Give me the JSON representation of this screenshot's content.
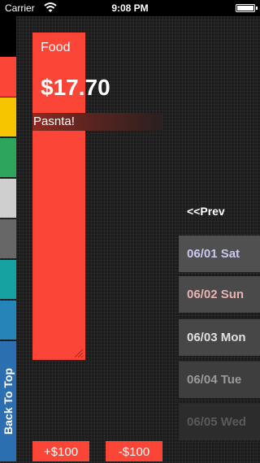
{
  "statusbar": {
    "carrier": "Carrier",
    "time": "9:08 PM"
  },
  "category_strip": [
    {
      "name": "black",
      "color": "#000000"
    },
    {
      "name": "red",
      "color": "#fb4637"
    },
    {
      "name": "yellow",
      "color": "#f6c500"
    },
    {
      "name": "green",
      "color": "#2ea55c"
    },
    {
      "name": "light-gray",
      "color": "#cfcfcf"
    },
    {
      "name": "dark-gray",
      "color": "#676767"
    },
    {
      "name": "teal",
      "color": "#16a2a0"
    },
    {
      "name": "blue",
      "color": "#2784b9"
    }
  ],
  "back_to_top": "Back To Top",
  "entry": {
    "category": "Food",
    "amount": "$17.70",
    "note": "Pasnta!",
    "color": "#fb4637"
  },
  "nav": {
    "prev_label": "<<Prev",
    "days": [
      "06/01 Sat",
      "06/02 Sun",
      "06/03 Mon",
      "06/04 Tue",
      "06/05 Wed"
    ]
  },
  "buttons": {
    "plus_label": "+$100",
    "minus_label": "-$100"
  }
}
